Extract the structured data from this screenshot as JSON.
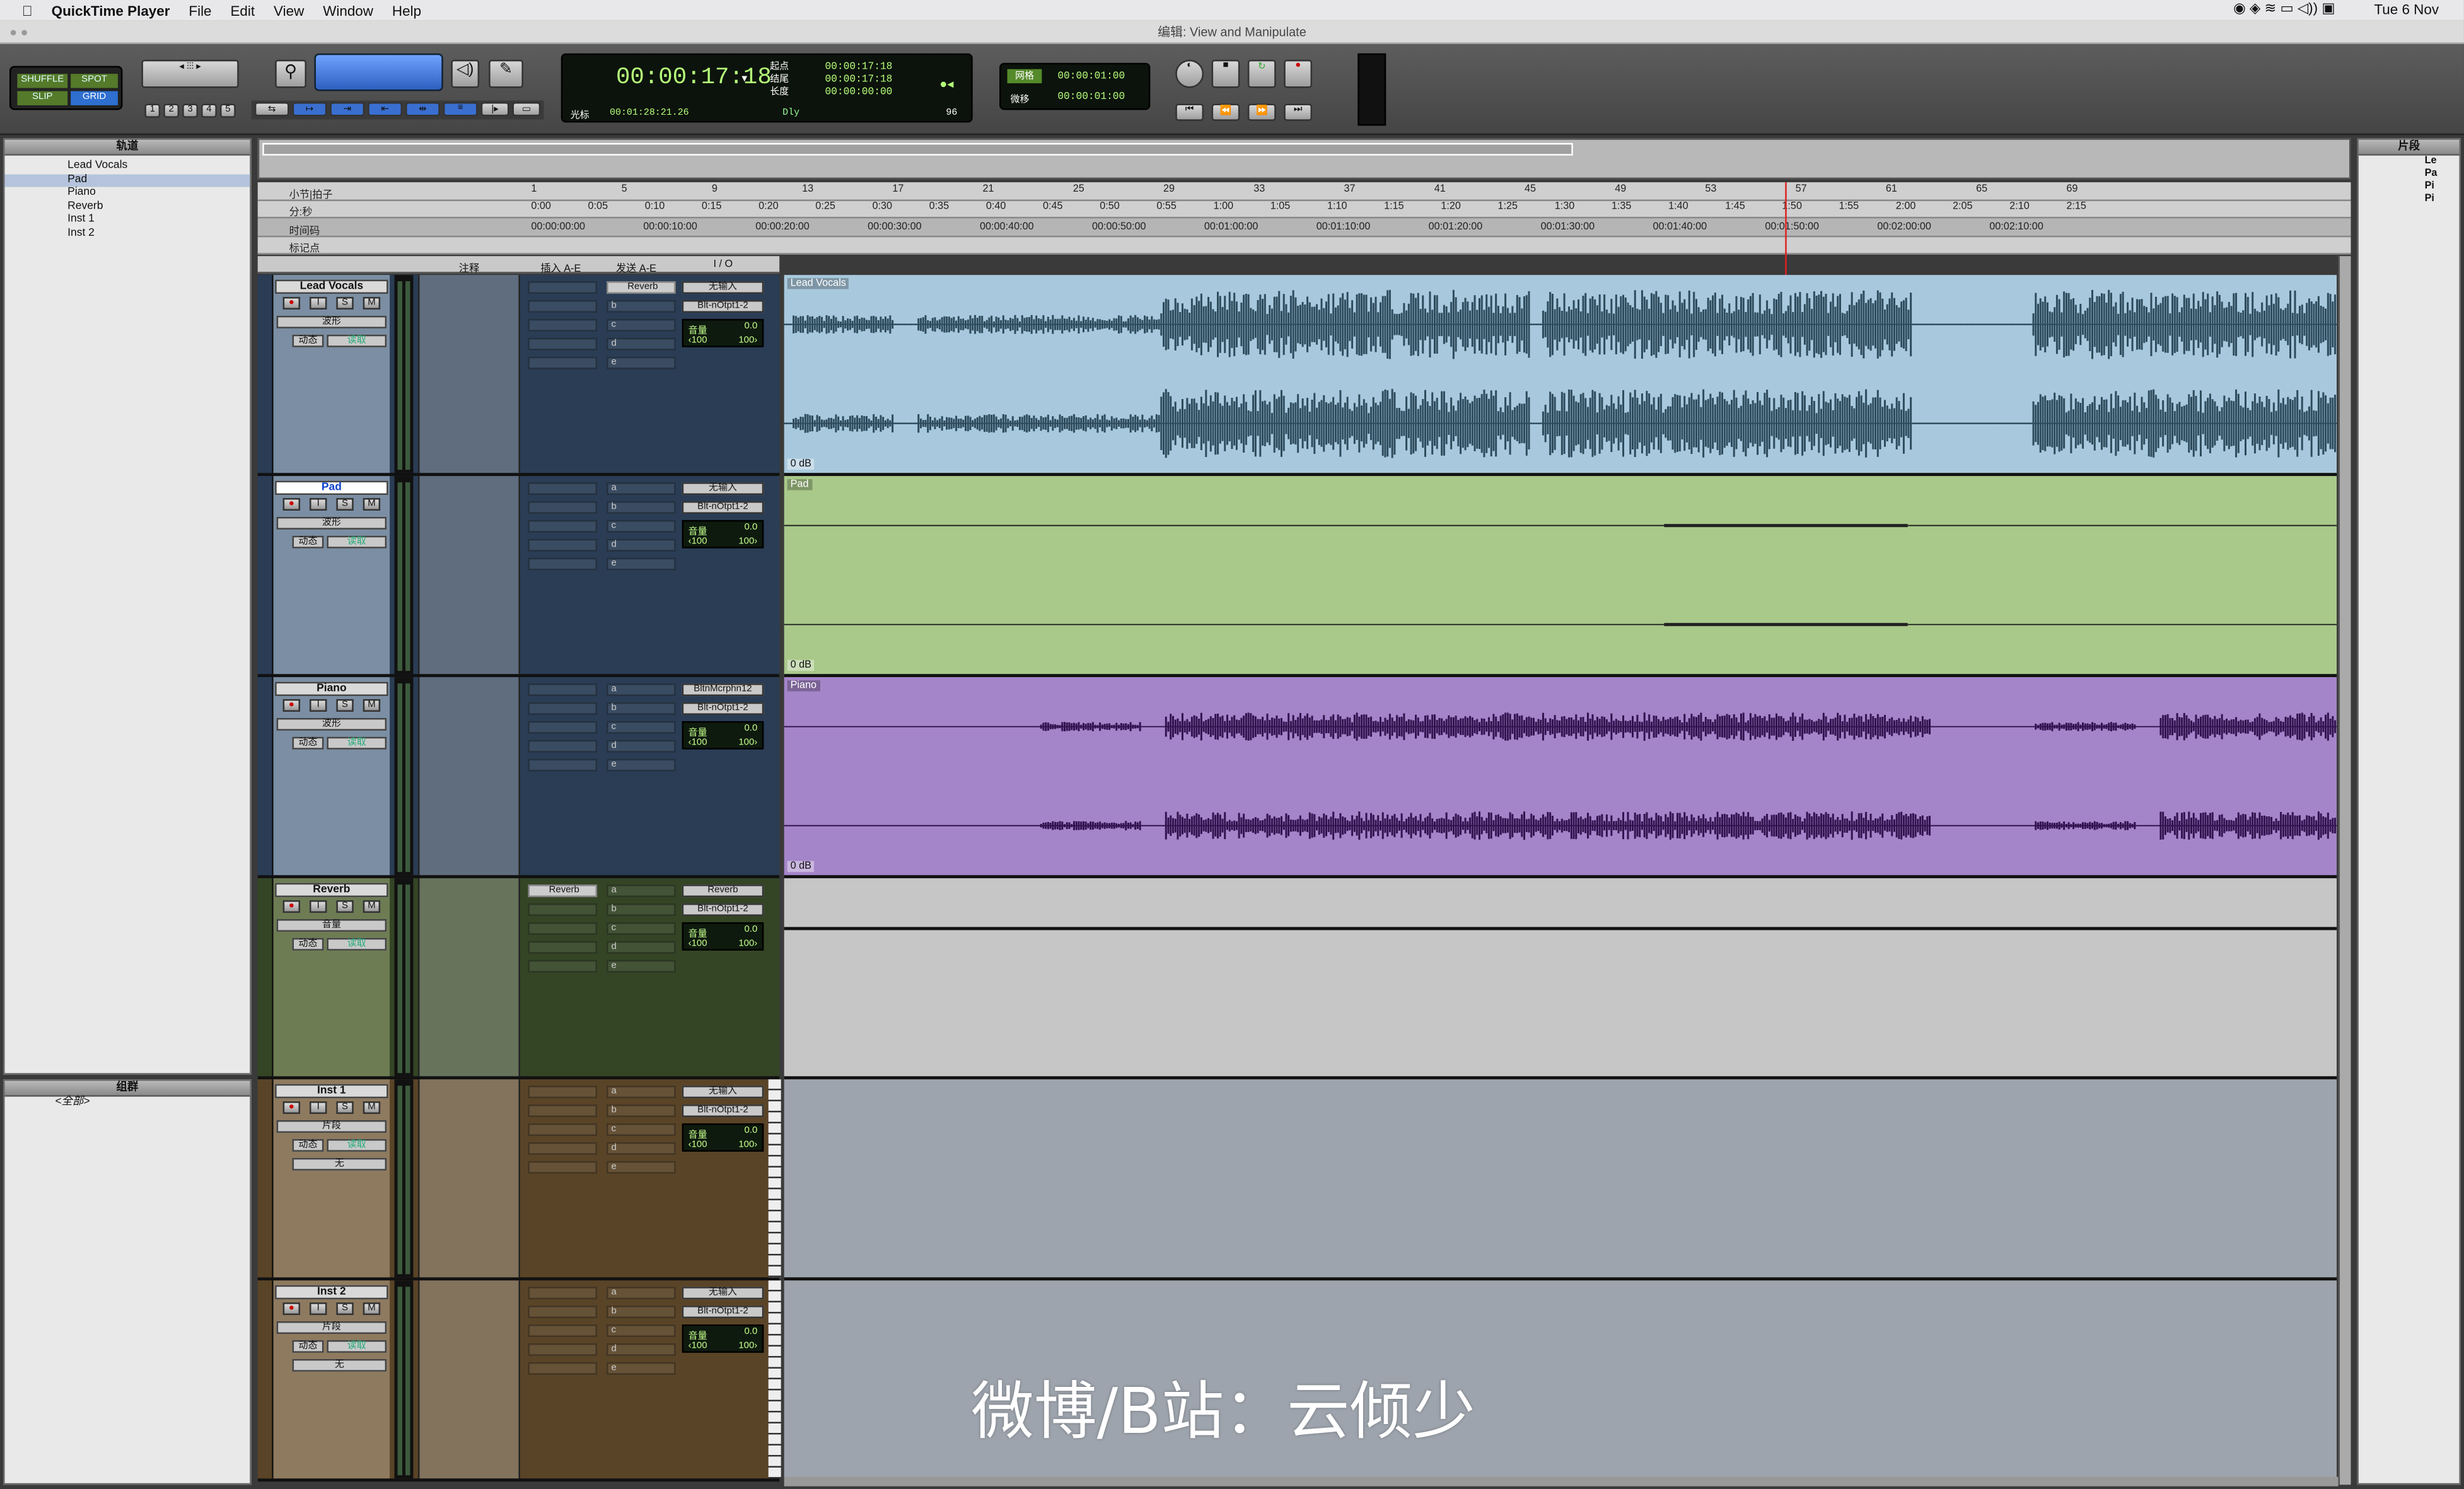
{
  "menubar": {
    "app": "QuickTime Player",
    "items": [
      "File",
      "Edit",
      "View",
      "Window",
      "Help"
    ],
    "clock": "Tue 6 Nov"
  },
  "window": {
    "title": "编辑:  View and Manipulate"
  },
  "modes": {
    "shuffle": "SHUFFLE",
    "spot": "SPOT",
    "slip": "SLIP",
    "grid": "GRID"
  },
  "zoom_presets": [
    "1",
    "2",
    "3",
    "4",
    "5"
  ],
  "counter": {
    "main": "00:00:17:18",
    "start_label": "起点",
    "end_label": "结尾",
    "length_label": "长度",
    "start": "00:00:17:18",
    "end": "00:00:17:18",
    "length": "00:00:00:00",
    "cursor_label": "光标",
    "cursor": "00:01:28:21.26",
    "dly": "Dly",
    "bpm": "96"
  },
  "grid": {
    "grid_label": "网格",
    "grid_value": "00:00:01:00",
    "nudge_label": "微移",
    "nudge_value": "00:00:01:00"
  },
  "panels": {
    "tracks_title": "轨道",
    "groups_title": "组群",
    "clips_title": "片段",
    "group_all": "<全部>",
    "track_list": [
      "Lead Vocals",
      "Pad",
      "Piano",
      "Reverb",
      "Inst 1",
      "Inst 2"
    ],
    "clip_list": [
      "Le",
      "Pa",
      "Pi",
      "Pi"
    ]
  },
  "rulers": {
    "bars_label": "小节|拍子",
    "minsec_label": "分:秒",
    "timecode_label": "时间码",
    "markers_label": "标记点",
    "bars": [
      "1",
      "5",
      "9",
      "13",
      "17",
      "21",
      "25",
      "29",
      "33",
      "37",
      "41",
      "45",
      "49",
      "53",
      "57",
      "61",
      "65",
      "69"
    ],
    "minsec": [
      "0:00",
      "0:05",
      "0:10",
      "0:15",
      "0:20",
      "0:25",
      "0:30",
      "0:35",
      "0:40",
      "0:45",
      "0:50",
      "0:55",
      "1:00",
      "1:05",
      "1:10",
      "1:15",
      "1:20",
      "1:25",
      "1:30",
      "1:35",
      "1:40",
      "1:45",
      "1:50",
      "1:55",
      "2:00",
      "2:05",
      "2:10",
      "2:15"
    ],
    "timecode": [
      "00:00:00:00",
      "00:00:10:00",
      "00:00:20:00",
      "00:00:30:00",
      "00:00:40:00",
      "00:00:50:00",
      "00:01:00:00",
      "00:01:10:00",
      "00:01:20:00",
      "00:01:30:00",
      "00:01:40:00",
      "00:01:50:00",
      "00:02:00:00",
      "00:02:10:00"
    ]
  },
  "columns": {
    "comments": "注释",
    "inserts": "插入 A-E",
    "sends": "发送 A-E",
    "io": "I / O"
  },
  "slot_letters": [
    "a",
    "b",
    "c",
    "d",
    "e"
  ],
  "tracks": [
    {
      "name": "Lead Vocals",
      "view": "波形",
      "auto": "动态",
      "mode": "读取",
      "io_in": "无输入",
      "io_out": "Blt-nOtpt1-2",
      "vol_label": "音量",
      "vol": "0.0",
      "pan_l": "‹100",
      "pan_r": "100›",
      "send": "Reverb",
      "insert": "",
      "region": "Lead Vocals",
      "gain": "0 dB"
    },
    {
      "name": "Pad",
      "view": "波形",
      "auto": "动态",
      "mode": "读取",
      "io_in": "无输入",
      "io_out": "Blt-nOtpt1-2",
      "vol_label": "音量",
      "vol": "0.0",
      "pan_l": "‹100",
      "pan_r": "100›",
      "send": "",
      "insert": "",
      "region": "Pad",
      "gain": "0 dB"
    },
    {
      "name": "Piano",
      "view": "波形",
      "auto": "动态",
      "mode": "读取",
      "io_in": "BltnMcrphn12",
      "io_out": "Blt-nOtpt1-2",
      "vol_label": "音量",
      "vol": "0.0",
      "pan_l": "‹100",
      "pan_r": "100›",
      "send": "",
      "insert": "",
      "region": "Piano",
      "gain": "0 dB"
    },
    {
      "name": "Reverb",
      "view": "音量",
      "auto": "动态",
      "mode": "读取",
      "io_in": "Reverb",
      "io_out": "Blt-nOtpt1-2",
      "vol_label": "音量",
      "vol": "0.0",
      "pan_l": "‹100",
      "pan_r": "100›",
      "send": "",
      "insert": "Reverb",
      "region": "",
      "gain": ""
    },
    {
      "name": "Inst 1",
      "view": "片段",
      "auto": "动态",
      "mode": "读取",
      "io_in": "无输入",
      "io_out": "Blt-nOtpt1-2",
      "vol_label": "音量",
      "vol": "0.0",
      "pan_l": "‹100",
      "pan_r": "100›",
      "send": "",
      "insert": "",
      "region": "",
      "gain": "",
      "patch": "无"
    },
    {
      "name": "Inst 2",
      "view": "片段",
      "auto": "动态",
      "mode": "读取",
      "io_in": "无输入",
      "io_out": "Blt-nOtpt1-2",
      "vol_label": "音量",
      "vol": "0.0",
      "pan_l": "‹100",
      "pan_r": "100›",
      "send": "",
      "insert": "",
      "region": "",
      "gain": "",
      "patch": "无"
    }
  ],
  "watermark": "微博/B站：云倾少",
  "colors": {
    "lead_region": "#a8c9dd",
    "pad_region": "#a9c98a",
    "piano_region": "#a585c9",
    "reverb_region": "#c6c6c6",
    "inst_region": "#9ea4ad",
    "lead_hdr": "#6c7d8f",
    "reverb_hdr": "#5f6b4d",
    "inst_hdr": "#8a7156",
    "playhead": "#e02020"
  }
}
